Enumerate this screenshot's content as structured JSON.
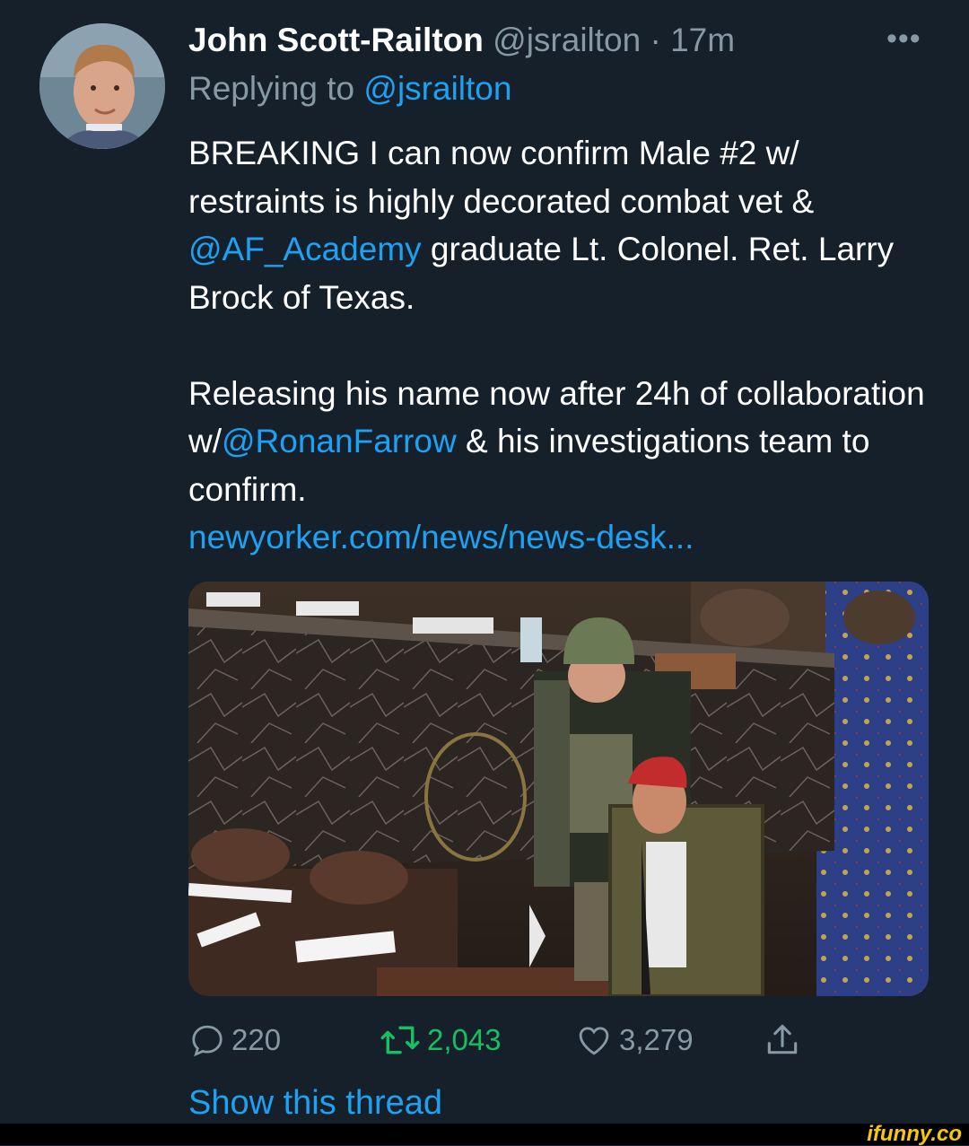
{
  "tweet": {
    "author_name": "John Scott-Railton",
    "handle": "@jsrailton",
    "separator": "·",
    "time": "17m",
    "more_glyph": "•••",
    "replying_prefix": "Replying to",
    "replying_to": "@jsrailton",
    "body": {
      "p1_part1": "BREAKING I can now confirm Male #2 w/ restraints is highly decorated combat vet &",
      "p1_mention": "@AF_Academy",
      "p1_part2": " graduate Lt. Colonel. Ret. Larry Brock of Texas.",
      "p2_part1": "Releasing his name now after 24h of collaboration w/",
      "p2_mention": "@RonanFarrow",
      "p2_part2": " & his investigations team to confirm.",
      "link": "newyorker.com/news/news-desk..."
    },
    "media_icon": "photo-image",
    "stats": {
      "replies": "220",
      "retweets": "2,043",
      "likes": "3,279"
    },
    "icons": {
      "reply": "reply-icon",
      "retweet": "retweet-icon",
      "like": "like-icon",
      "share": "share-icon"
    },
    "show_thread": "Show this thread"
  },
  "colors": {
    "background": "#15202b",
    "link": "#1da1f2",
    "muted": "#8899a6",
    "retweet_active": "#17bf63"
  },
  "watermark": "ifunny.co"
}
